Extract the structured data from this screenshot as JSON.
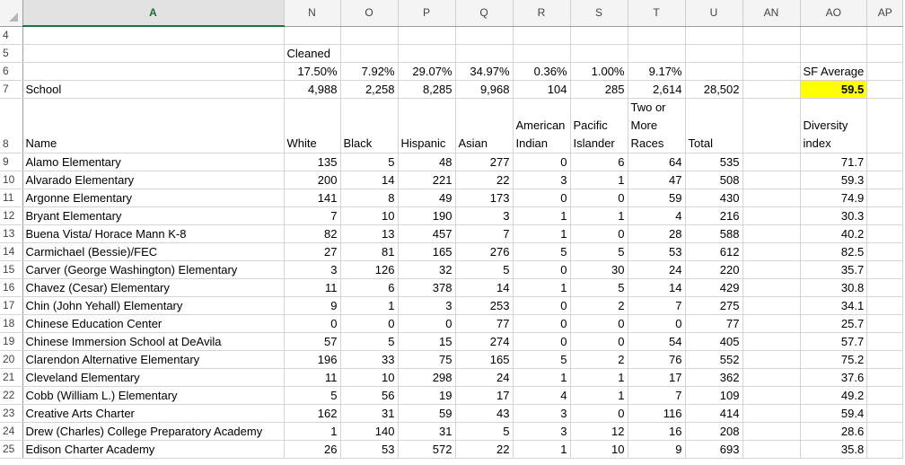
{
  "columns": [
    "A",
    "N",
    "O",
    "P",
    "Q",
    "R",
    "S",
    "T",
    "U",
    "AN",
    "AO",
    "AP"
  ],
  "rows_top": [
    {
      "num": "4",
      "cells": [
        "",
        "",
        "",
        "",
        "",
        "",
        "",
        "",
        "",
        "",
        "",
        ""
      ]
    },
    {
      "num": "5",
      "cells": [
        "",
        "Cleaned",
        "",
        "",
        "",
        "",
        "",
        "",
        "",
        "",
        "",
        ""
      ]
    },
    {
      "num": "6",
      "cells": [
        "",
        "17.50%",
        "7.92%",
        "29.07%",
        "34.97%",
        "0.36%",
        "1.00%",
        "9.17%",
        "",
        "",
        "SF Average",
        ""
      ]
    },
    {
      "num": "7",
      "cells": [
        "School",
        "4,988",
        "2,258",
        "8,285",
        "9,968",
        "104",
        "285",
        "2,614",
        "28,502",
        "",
        "59.5",
        ""
      ]
    }
  ],
  "header_row": {
    "num": "8",
    "cells": [
      "Name",
      "White",
      "Black",
      "Hispanic",
      "Asian",
      "American Indian",
      "Pacific Islander",
      "Two or More Races",
      "Total",
      "",
      "Diversity index",
      ""
    ]
  },
  "data_rows": [
    {
      "num": "9",
      "cells": [
        "Alamo Elementary",
        "135",
        "5",
        "48",
        "277",
        "0",
        "6",
        "64",
        "535",
        "",
        "71.7",
        ""
      ]
    },
    {
      "num": "10",
      "cells": [
        "Alvarado Elementary",
        "200",
        "14",
        "221",
        "22",
        "3",
        "1",
        "47",
        "508",
        "",
        "59.3",
        ""
      ]
    },
    {
      "num": "11",
      "cells": [
        "Argonne Elementary",
        "141",
        "8",
        "49",
        "173",
        "0",
        "0",
        "59",
        "430",
        "",
        "74.9",
        ""
      ]
    },
    {
      "num": "12",
      "cells": [
        "Bryant Elementary",
        "7",
        "10",
        "190",
        "3",
        "1",
        "1",
        "4",
        "216",
        "",
        "30.3",
        ""
      ]
    },
    {
      "num": "13",
      "cells": [
        "Buena Vista/ Horace Mann K-8",
        "82",
        "13",
        "457",
        "7",
        "1",
        "0",
        "28",
        "588",
        "",
        "40.2",
        ""
      ]
    },
    {
      "num": "14",
      "cells": [
        "Carmichael (Bessie)/FEC",
        "27",
        "81",
        "165",
        "276",
        "5",
        "5",
        "53",
        "612",
        "",
        "82.5",
        ""
      ]
    },
    {
      "num": "15",
      "cells": [
        "Carver (George Washington) Elementary",
        "3",
        "126",
        "32",
        "5",
        "0",
        "30",
        "24",
        "220",
        "",
        "35.7",
        ""
      ]
    },
    {
      "num": "16",
      "cells": [
        "Chavez (Cesar) Elementary",
        "11",
        "6",
        "378",
        "14",
        "1",
        "5",
        "14",
        "429",
        "",
        "30.8",
        ""
      ]
    },
    {
      "num": "17",
      "cells": [
        "Chin (John Yehall) Elementary",
        "9",
        "1",
        "3",
        "253",
        "0",
        "2",
        "7",
        "275",
        "",
        "34.1",
        ""
      ]
    },
    {
      "num": "18",
      "cells": [
        "Chinese Education Center",
        "0",
        "0",
        "0",
        "77",
        "0",
        "0",
        "0",
        "77",
        "",
        "25.7",
        ""
      ]
    },
    {
      "num": "19",
      "cells": [
        "Chinese Immersion School at DeAvila",
        "57",
        "5",
        "15",
        "274",
        "0",
        "0",
        "54",
        "405",
        "",
        "57.7",
        ""
      ]
    },
    {
      "num": "20",
      "cells": [
        "Clarendon Alternative Elementary",
        "196",
        "33",
        "75",
        "165",
        "5",
        "2",
        "76",
        "552",
        "",
        "75.2",
        ""
      ]
    },
    {
      "num": "21",
      "cells": [
        "Cleveland Elementary",
        "11",
        "10",
        "298",
        "24",
        "1",
        "1",
        "17",
        "362",
        "",
        "37.6",
        ""
      ]
    },
    {
      "num": "22",
      "cells": [
        "Cobb (William L.) Elementary",
        "5",
        "56",
        "19",
        "17",
        "4",
        "1",
        "7",
        "109",
        "",
        "49.2",
        ""
      ]
    },
    {
      "num": "23",
      "cells": [
        "Creative Arts Charter",
        "162",
        "31",
        "59",
        "43",
        "3",
        "0",
        "116",
        "414",
        "",
        "59.4",
        ""
      ]
    },
    {
      "num": "24",
      "cells": [
        "Drew (Charles) College Preparatory Academy",
        "1",
        "140",
        "31",
        "5",
        "3",
        "12",
        "16",
        "208",
        "",
        "28.6",
        ""
      ]
    },
    {
      "num": "25",
      "cells": [
        "Edison Charter Academy",
        "26",
        "53",
        "572",
        "22",
        "1",
        "10",
        "9",
        "693",
        "",
        "35.8",
        ""
      ]
    }
  ],
  "highlight_color": "#ffff00",
  "active_column": "A"
}
